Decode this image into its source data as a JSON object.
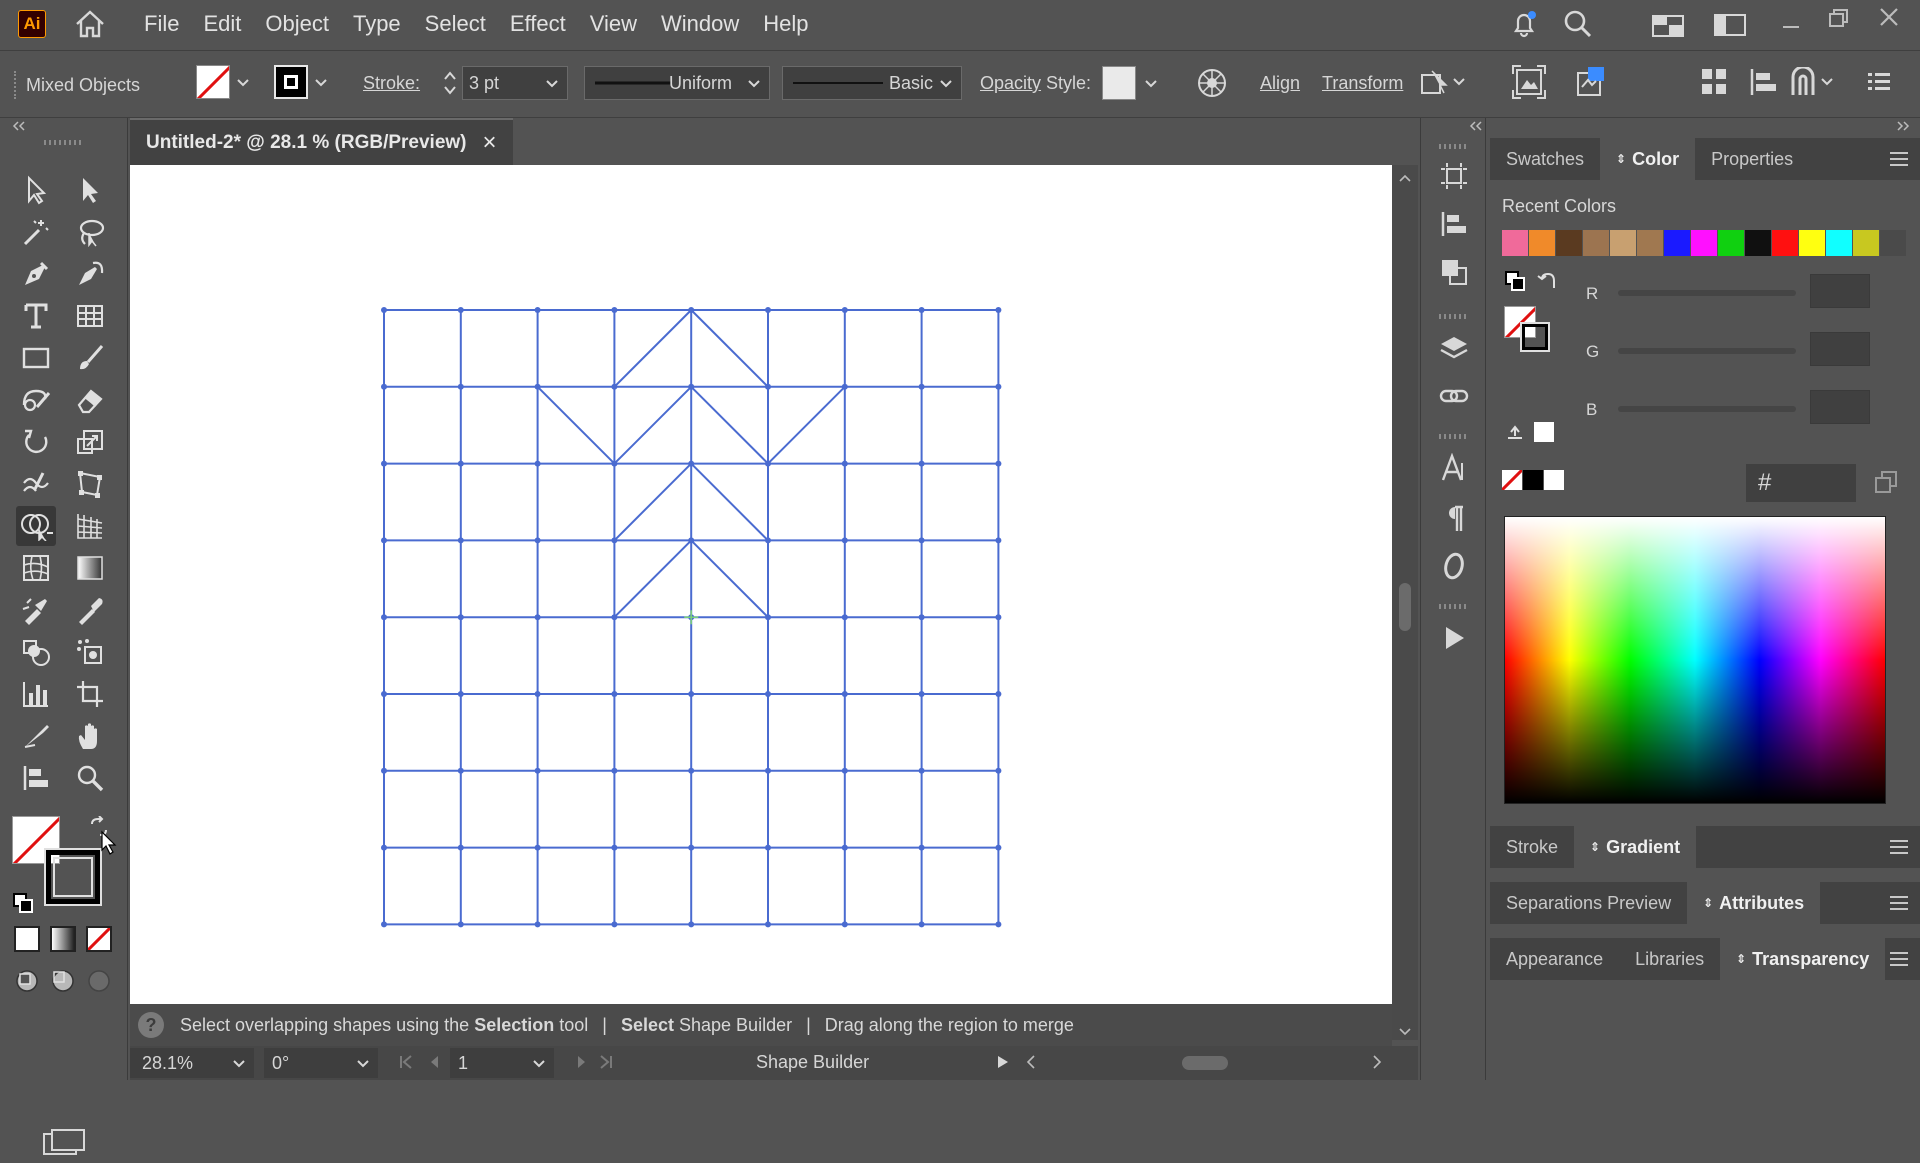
{
  "app": {
    "logo_text": "Ai"
  },
  "menu": [
    "File",
    "Edit",
    "Object",
    "Type",
    "Select",
    "Effect",
    "View",
    "Window",
    "Help"
  ],
  "control": {
    "selection_label": "Mixed Objects",
    "stroke_label": "Stroke:",
    "stroke_value": "3 pt",
    "profile_label": "Uniform",
    "brush_label": "Basic",
    "opacity_label": "Opacity",
    "style_label": "Style:",
    "align_label": "Align",
    "transform_label": "Transform"
  },
  "document": {
    "tab_title": "Untitled-2* @ 28.1 % (RGB/Preview)",
    "close_glyph": "×"
  },
  "status": {
    "help_glyph": "?",
    "seg1_prefix": "Select overlapping shapes using the",
    "seg1_bold": "Selection",
    "seg1_suffix": "tool",
    "sep": "|",
    "seg2_bold": "Select",
    "seg2_rest": "Shape Builder",
    "seg3": "Drag along the region to merge"
  },
  "bottom": {
    "zoom": "28.1%",
    "rotation": "0°",
    "artboard_num": "1",
    "current_tool": "Shape Builder"
  },
  "panel_top": {
    "tabs": [
      "Swatches",
      "Color",
      "Properties"
    ],
    "active": "Color",
    "recent_colors_label": "Recent Colors",
    "recent_colors": [
      "#f06a9a",
      "#f08a2a",
      "#5a3a20",
      "#9c7450",
      "#c8a070",
      "#a07850",
      "#1a1aff",
      "#ff10ff",
      "#10d010",
      "#101010",
      "#ff1010",
      "#ffff10",
      "#10ffff",
      "#c8c820"
    ],
    "channels": [
      "R",
      "G",
      "B"
    ],
    "hex_symbol": "#"
  },
  "panel_stroke": {
    "tabs": [
      "Stroke",
      "Gradient"
    ],
    "active": "Gradient"
  },
  "panel_sep": {
    "tabs": [
      "Separations Preview",
      "Attributes"
    ],
    "active": "Attributes"
  },
  "panel_app": {
    "tabs": [
      "Appearance",
      "Libraries",
      "Transparency"
    ],
    "active": "Transparency"
  },
  "colors": {
    "grid_stroke": "#4a6bd0",
    "anchor": "#4a6bd0",
    "panel_bg": "#535353"
  }
}
